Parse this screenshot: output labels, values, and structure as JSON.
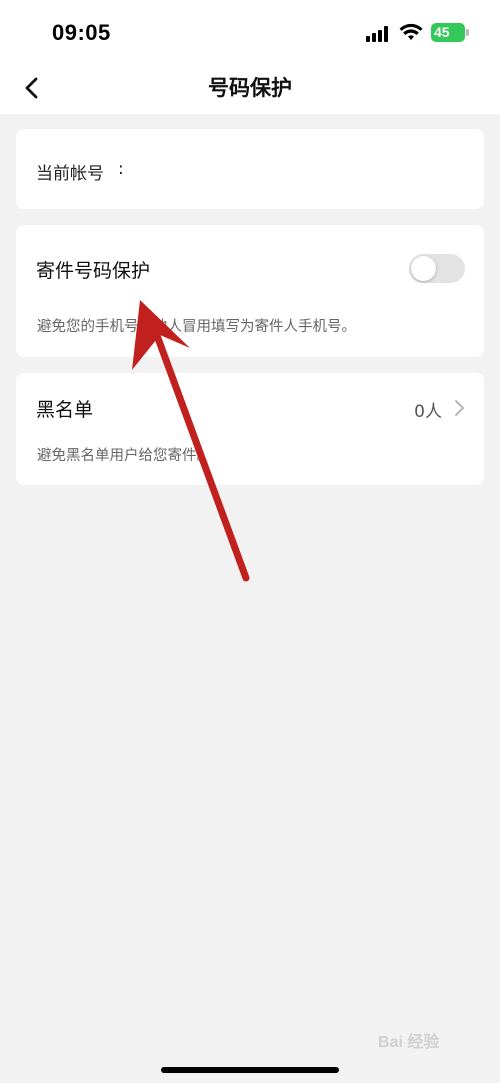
{
  "status_bar": {
    "time": "09:05",
    "battery": "45"
  },
  "nav": {
    "title": "号码保护"
  },
  "account": {
    "label": "当前帐号",
    "value": ""
  },
  "protection": {
    "title": "寄件号码保护",
    "description": "避免您的手机号被他人冒用填写为寄件人手机号。",
    "enabled": false
  },
  "blacklist": {
    "title": "黑名单",
    "count": "0人",
    "description": "避免黑名单用户给您寄件。"
  },
  "watermark": "Bai 经验",
  "colors": {
    "background": "#f2f2f2",
    "card": "#ffffff",
    "annotation_arrow": "#c0201e",
    "battery": "#34c759"
  }
}
